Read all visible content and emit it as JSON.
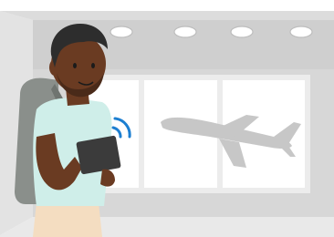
{
  "scene": {
    "subject": "traveler-with-tablet",
    "icons": [
      "wifi-signal-icon",
      "airplane-icon",
      "ceiling-light-icon",
      "backpack-icon",
      "tablet-icon"
    ],
    "colors": {
      "wall": "#d7d7d7",
      "ceiling": "#cfcfcf",
      "floor": "#e8e8e8",
      "window_frame": "#ececec",
      "window_glass": "#ffffff",
      "plane": "#c7c7c7",
      "light": "#ffffff",
      "skin": "#6a3b22",
      "hair": "#2d2d2d",
      "shirt": "#cfeee9",
      "backpack": "#8a8f8b",
      "pants": "#f4ddc1",
      "tablet": "#3b3b3b",
      "wifi": "#1d7fd1"
    }
  }
}
